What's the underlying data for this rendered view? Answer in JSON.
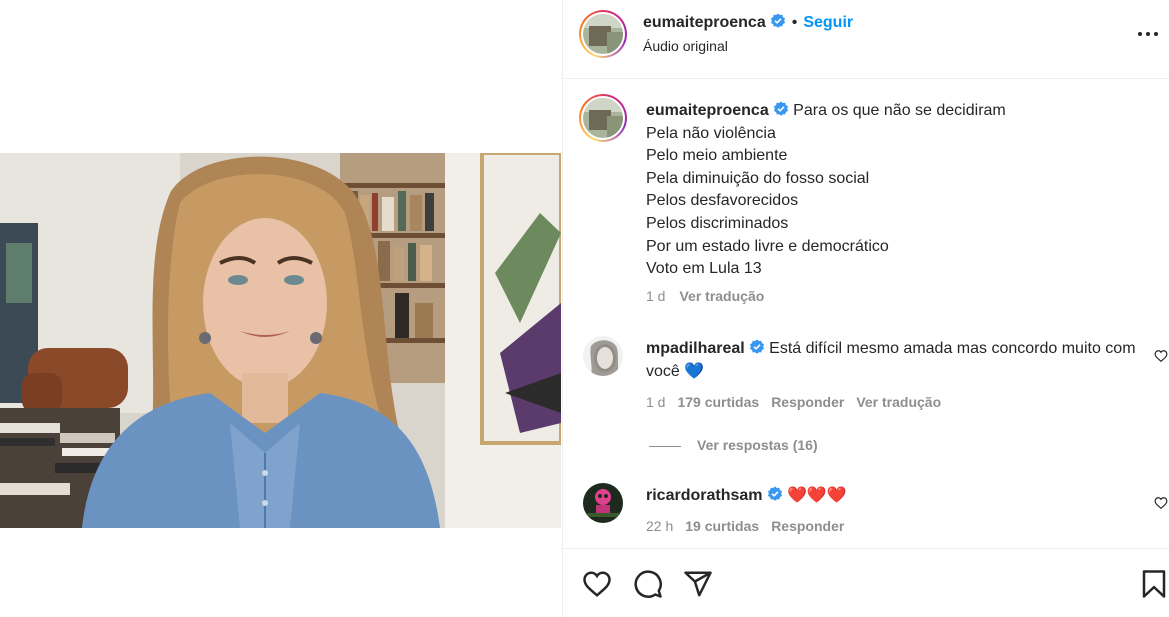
{
  "post": {
    "author": "eumaiteproenca",
    "follow_label": "Seguir",
    "separator": "•",
    "audio": "Áudio original"
  },
  "caption": {
    "author": "eumaiteproenca",
    "first_line": "Para os que não se decidiram",
    "lines": [
      "Pela não violência",
      "Pelo meio ambiente",
      "Pela diminuição do fosso social",
      "Pelos desfavorecidos",
      "Pelos discriminados",
      "Por um estado livre e democrático",
      "Voto em Lula 13"
    ],
    "time": "1 d",
    "translate_label": "Ver tradução"
  },
  "comments": [
    {
      "author": "mpadilhareal",
      "text": "Está difícil mesmo amada mas concordo muito com você",
      "emoji": "💙",
      "time": "1 d",
      "likes": "179 curtidas",
      "reply_label": "Responder",
      "translate_label": "Ver tradução",
      "view_replies": "Ver respostas (16)"
    },
    {
      "author": "ricardorathsam",
      "text": "",
      "emoji": "❤️❤️❤️",
      "time": "22 h",
      "likes": "19 curtidas",
      "reply_label": "Responder"
    }
  ],
  "colors": {
    "accent": "#0095f6",
    "verified": "#3897f0",
    "muted": "#8e8e8e",
    "text": "#262626",
    "heart": "#e0245e",
    "blue_heart": "#1f6feb"
  },
  "icons": [
    "verified-badge-icon",
    "more-options-icon",
    "heart-icon",
    "comment-icon",
    "share-icon",
    "bookmark-icon"
  ]
}
